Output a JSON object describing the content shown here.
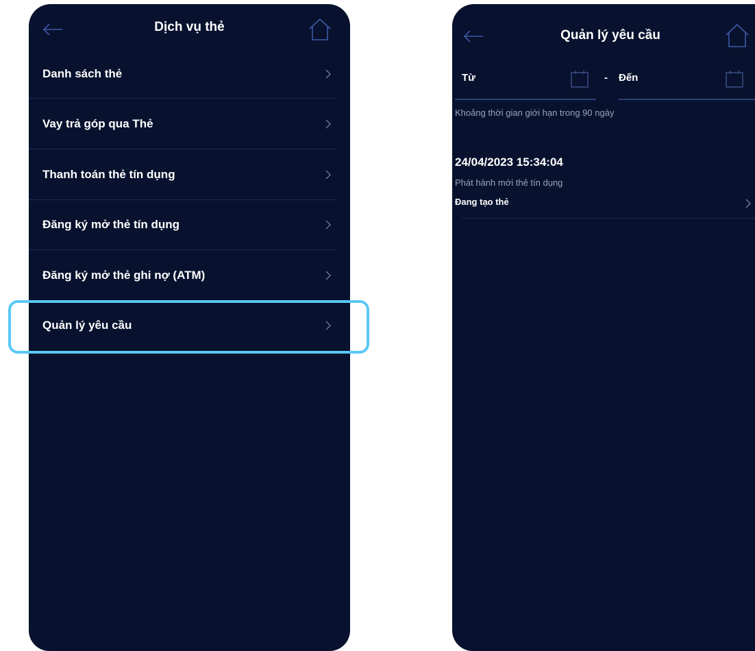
{
  "left_screen": {
    "title": "Dịch vụ thẻ",
    "menu": [
      {
        "label": "Danh sách thẻ"
      },
      {
        "label": "Vay trả góp qua Thẻ"
      },
      {
        "label": "Thanh toán thẻ tín dụng"
      },
      {
        "label": "Đăng ký mở thẻ tín dụng"
      },
      {
        "label": "Đăng ký mở thẻ ghi nợ (ATM)"
      },
      {
        "label": "Quản lý yêu cầu",
        "highlighted": true
      }
    ],
    "icons": {
      "back": "arrow-left-icon",
      "home": "home-icon",
      "item": "chevron-right-icon"
    }
  },
  "right_screen": {
    "title": "Quản lý yêu cầu",
    "filter": {
      "from_label": "Từ",
      "separator": "-",
      "to_label": "Đến",
      "hint": "Khoảng thời gian giới hạn trong 90 ngày"
    },
    "requests": [
      {
        "datetime": "24/04/2023 15:34:04",
        "type": "Phát hành mới thẻ tín dụng",
        "status": "Đang tạo thẻ"
      }
    ],
    "icons": {
      "back": "arrow-left-icon",
      "home": "home-icon",
      "calendar": "calendar-icon"
    }
  },
  "colors": {
    "background": "#08122e",
    "highlight": "#5ac8f5",
    "accent": "#2a3f7a"
  }
}
